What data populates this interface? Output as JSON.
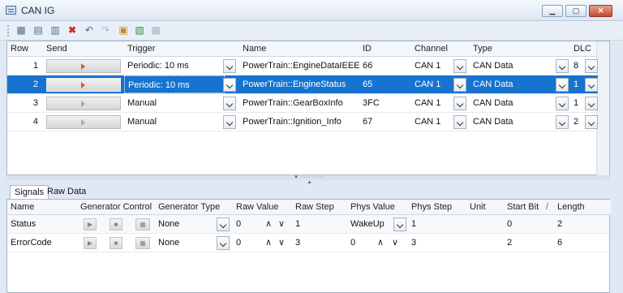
{
  "window": {
    "title": "CAN IG"
  },
  "messages": {
    "columns": [
      "Row",
      "Send",
      "Trigger",
      "Name",
      "ID",
      "Channel",
      "Type",
      "DLC"
    ],
    "rows": [
      {
        "row": "1",
        "trigger": "Periodic: 10 ms",
        "name": "PowerTrain::EngineDataIEEE",
        "id": "66",
        "channel": "CAN 1",
        "type": "CAN Data",
        "dlc": "8",
        "selected": false,
        "send_enabled": true
      },
      {
        "row": "2",
        "trigger": "Periodic: 10 ms",
        "name": "PowerTrain::EngineStatus",
        "id": "65",
        "channel": "CAN 1",
        "type": "CAN Data",
        "dlc": "1",
        "selected": true,
        "send_enabled": true
      },
      {
        "row": "3",
        "trigger": "Manual",
        "name": "PowerTrain::GearBoxInfo",
        "id": "3FC",
        "channel": "CAN 1",
        "type": "CAN Data",
        "dlc": "1",
        "selected": false,
        "send_enabled": false
      },
      {
        "row": "4",
        "trigger": "Manual",
        "name": "PowerTrain::Ignition_Info",
        "id": "67",
        "channel": "CAN 1",
        "type": "CAN Data",
        "dlc": "2",
        "selected": false,
        "send_enabled": false
      }
    ]
  },
  "tabs": {
    "signals": "Signals",
    "raw": "Raw Data"
  },
  "signals": {
    "columns": [
      "Name",
      "Generator Control",
      "Generator Type",
      "Raw Value",
      "Raw Step",
      "Phys Value",
      "Phys Step",
      "Unit",
      "Start Bit",
      "Length"
    ],
    "sort_marker": "/",
    "rows": [
      {
        "name": "Status",
        "gen_type": "None",
        "raw_value": "0",
        "raw_step": "1",
        "phys_value": "WakeUp",
        "phys_step": "1",
        "unit": "",
        "start_bit": "0",
        "length": "2"
      },
      {
        "name": "ErrorCode",
        "gen_type": "None",
        "raw_value": "0",
        "raw_step": "3",
        "phys_value": "0",
        "phys_step": "3",
        "unit": "",
        "start_bit": "2",
        "length": "6"
      }
    ]
  },
  "toolbar_icons": [
    "add-message-icon",
    "add-frame-icon",
    "add-signal-icon",
    "delete-icon",
    "undo-icon",
    "redo-icon",
    "import-icon",
    "export-icon",
    "settings-icon"
  ],
  "colors": {
    "selection": "#1673cf",
    "send_arrow": "#d8583a"
  }
}
